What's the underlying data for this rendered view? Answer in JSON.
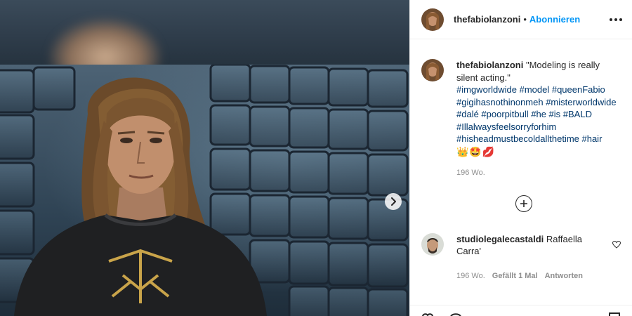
{
  "post": {
    "username": "thefabiolanzoni",
    "follow_label": "Abonnieren",
    "separator": "•"
  },
  "caption": {
    "username": "thefabiolanzoni",
    "text": "\"Modeling is really silent acting.\"",
    "hashtags": "#imgworldwide #model #queenFabio #gigihasnothinonmeh #misterworldwide #dalé #poorpitbull #he #is #BALD #Illalwaysfeelsorryforhim #hisheadmustbecoldallthetime #hair",
    "emojis": "👑🤩💋",
    "time": "196 Wo."
  },
  "comment": {
    "username": "studiolegalecastaldi",
    "text": "Raffaella Carra'",
    "time": "196 Wo.",
    "likes": "Gefällt 1 Mal",
    "reply_label": "Antworten"
  },
  "icons": {
    "more": "more-options-icon",
    "next": "chevron-right-icon",
    "load_more": "plus-circle-icon",
    "like": "heart-icon"
  },
  "colors": {
    "follow": "#0095f6",
    "hashtag": "#00376b",
    "muted": "#8e8e8e",
    "text": "#262626"
  }
}
